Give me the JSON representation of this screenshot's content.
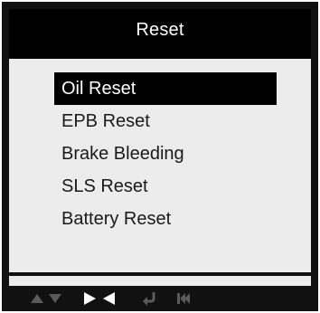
{
  "header": {
    "title": "Reset"
  },
  "menu": {
    "selected_index": 0,
    "items": [
      {
        "label": "Oil Reset"
      },
      {
        "label": "EPB Reset"
      },
      {
        "label": "Brake Bleeding"
      },
      {
        "label": "SLS Reset"
      },
      {
        "label": "Battery Reset"
      }
    ]
  },
  "keybar": {
    "icons": [
      "up-arrow-icon",
      "down-arrow-icon",
      "right-arrow-icon",
      "left-arrow-icon",
      "enter-return-icon",
      "back-exit-icon"
    ]
  },
  "colors": {
    "bezel": "#111111",
    "screen_background": "#ececec",
    "highlight": "#000000",
    "highlight_text": "#ffffff",
    "inactive_key_icon": "#5a5a5a",
    "active_key_icon": "#ffffff"
  }
}
